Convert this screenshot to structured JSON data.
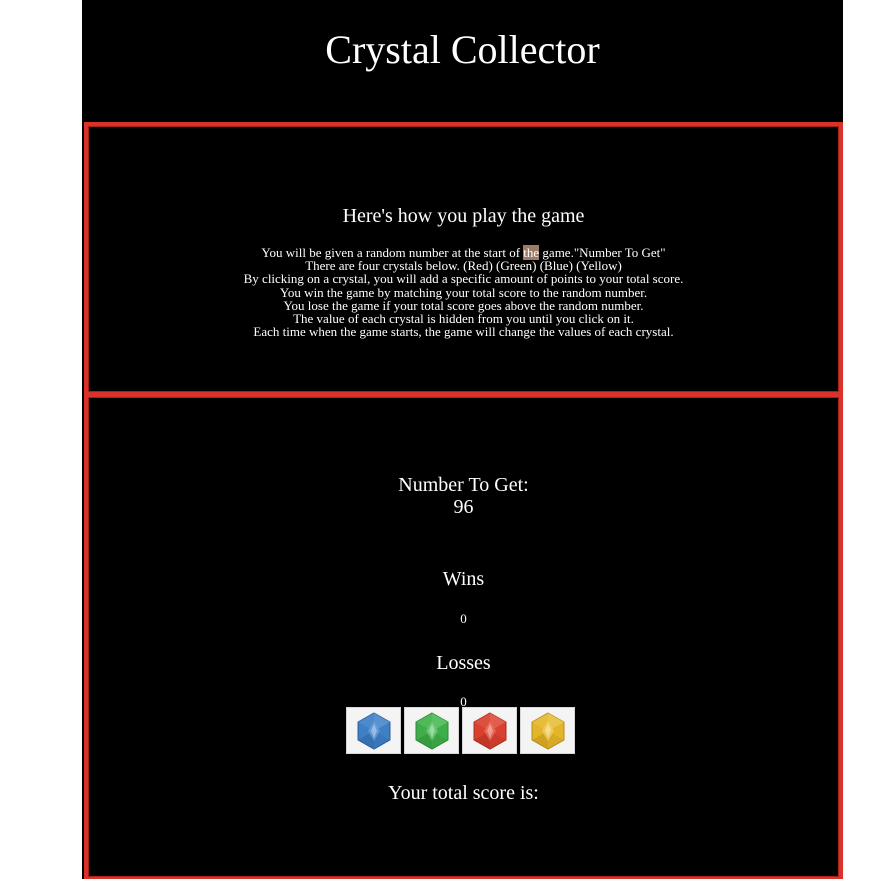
{
  "header": {
    "title": "Crystal Collector"
  },
  "rules": {
    "heading": "Here's how you play the game",
    "line1_before": "You will be given a random number at the start of ",
    "line1_highlight": "the",
    "line1_after": " game.\"Number To Get\"",
    "lines": [
      "There are four crystals below. (Red) (Green) (Blue) (Yellow)",
      "By clicking on a crystal, you will add a specific amount of points to your total score.",
      "You win the game by matching your total score to the random number.",
      "You lose the game if your total score goes above the random number.",
      "The value of each crystal is hidden from you until you click on it.",
      "Each time when the game starts, the game will change the values of each crystal."
    ]
  },
  "game": {
    "number_to_get_label": "Number To Get:",
    "number_to_get_value": "96",
    "wins_label": "Wins",
    "wins_value": "0",
    "losses_label": "Losses",
    "losses_value": "0",
    "total_score_label": "Your total score is:"
  },
  "crystals": [
    {
      "name": "blue",
      "icon": "blue-crystal-icon",
      "color": "#3f7fc4",
      "dark": "#2c5f9a",
      "light": "#6ea3db"
    },
    {
      "name": "green",
      "icon": "green-crystal-icon",
      "color": "#3fae4a",
      "dark": "#2c8735",
      "light": "#74cf7c"
    },
    {
      "name": "red",
      "icon": "red-crystal-icon",
      "color": "#d8412f",
      "dark": "#a92f20",
      "light": "#ec7564"
    },
    {
      "name": "yellow",
      "icon": "yellow-crystal-icon",
      "color": "#e3b52a",
      "dark": "#b78c16",
      "light": "#f3d166"
    }
  ],
  "colors": {
    "background": "#000000",
    "border_accent": "#d9322a",
    "text": "#ffffff",
    "highlight": "#9c7b68"
  }
}
